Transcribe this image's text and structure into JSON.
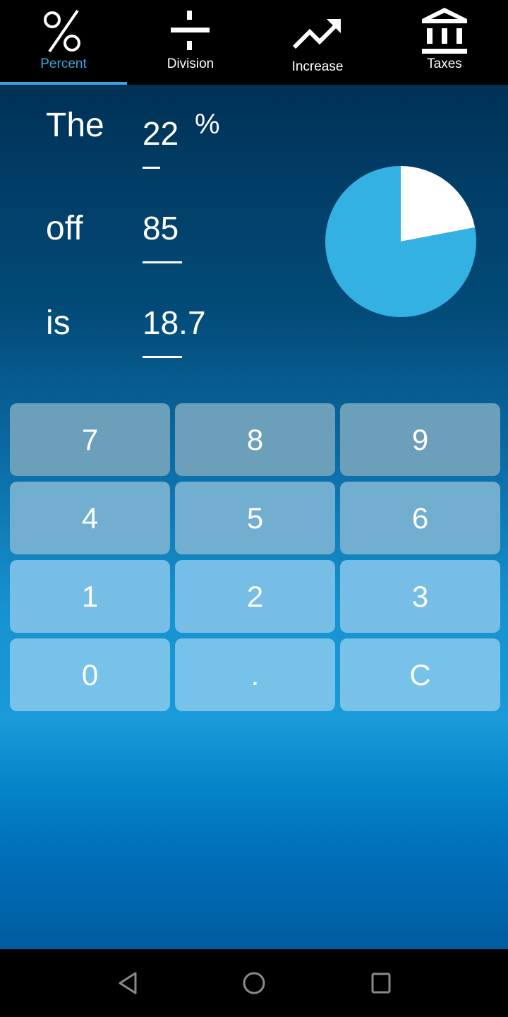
{
  "tabs": [
    {
      "label": "Percent",
      "icon": "percent-icon",
      "active": true
    },
    {
      "label": "Division",
      "icon": "division-icon",
      "active": false
    },
    {
      "label": "Increase",
      "icon": "trending-up-icon",
      "active": false
    },
    {
      "label": "Taxes",
      "icon": "bank-icon",
      "active": false
    }
  ],
  "colors": {
    "accent": "#33a7dc",
    "pie_fill": "#33b1e3",
    "pie_slice": "#ffffff"
  },
  "form": {
    "rows": [
      {
        "label": "The",
        "value": "22",
        "suffix": "%"
      },
      {
        "label": "off",
        "value": "85"
      },
      {
        "label": "is",
        "value": "18.7"
      }
    ]
  },
  "chart_data": {
    "type": "pie",
    "title": "",
    "slices": [
      {
        "name": "percent",
        "value": 22,
        "color": "#ffffff"
      },
      {
        "name": "remainder",
        "value": 78,
        "color": "#33b1e3"
      }
    ],
    "start_angle": "12 o'clock",
    "direction": "clockwise"
  },
  "keypad": {
    "keys": [
      [
        "7",
        "8",
        "9"
      ],
      [
        "4",
        "5",
        "6"
      ],
      [
        "1",
        "2",
        "3"
      ],
      [
        "0",
        ".",
        "C"
      ]
    ]
  },
  "navbar": {
    "buttons": [
      "back",
      "home",
      "recents"
    ]
  }
}
